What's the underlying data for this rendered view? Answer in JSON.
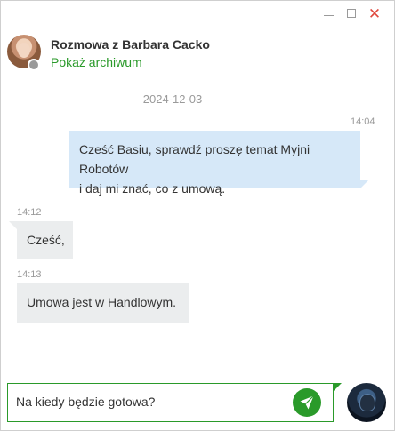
{
  "window": {
    "minimize_icon": "minimize-icon",
    "maximize_icon": "maximize-icon",
    "close_icon": "close-icon",
    "close_glyph": "✕"
  },
  "header": {
    "title": "Rozmowa z Barbara Cacko",
    "archive_link": "Pokaż archiwum",
    "status_color": "#9a9a9a"
  },
  "conversation": {
    "date": "2024-12-03",
    "messages": [
      {
        "direction": "out",
        "time": "14:04",
        "text_line1": "Cześć Basiu, sprawdź proszę temat Myjni Robotów",
        "text_line2": "i daj mi znać, co z umową."
      },
      {
        "direction": "in",
        "time": "14:12",
        "text": "Cześć,"
      },
      {
        "direction": "in",
        "time": "14:13",
        "text": "Umowa jest w Handlowym."
      }
    ]
  },
  "composer": {
    "value": "Na kiedy będzie gotowa?",
    "send_icon": "send-icon"
  },
  "colors": {
    "accent": "#2a9a2a",
    "outgoing_bubble": "#d6e8f8",
    "incoming_bubble": "#ebedee",
    "close": "#e04a3f"
  }
}
